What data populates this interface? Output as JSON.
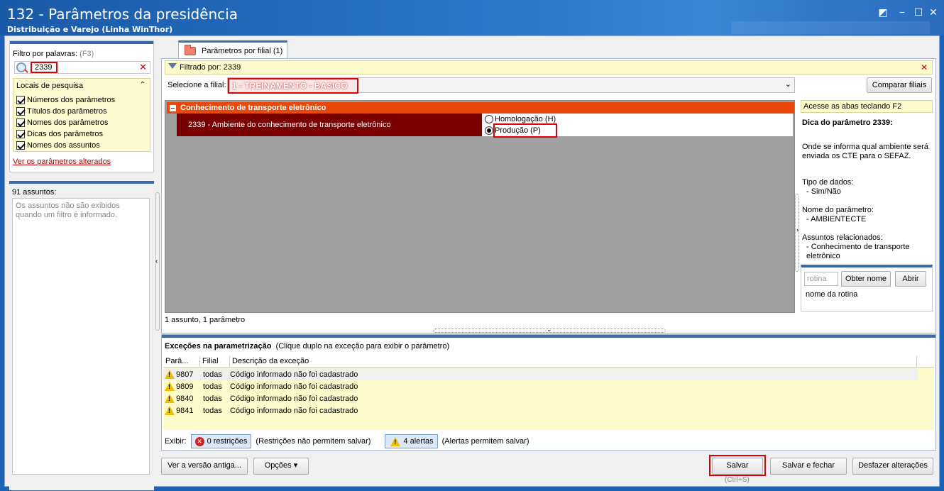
{
  "window": {
    "title": "132 - Parâmetros da presidência",
    "subtitle": "Distribuição e Varejo (Linha WinThor)",
    "controls": [
      "restore-icon",
      "minimize-icon",
      "maximize-icon",
      "close-icon"
    ]
  },
  "filter": {
    "label": "Filtro por palavras:",
    "shortcut": "(F3)",
    "value": "2339",
    "search_locations_title": "Locais de pesquisa",
    "locations": [
      "Números dos parâmetros",
      "Títulos dos parâmetros",
      "Nomes dos parâmetros",
      "Dicas dos parâmetros",
      "Nomes dos assuntos"
    ],
    "altered_link": "Ver os parâmetros alterados"
  },
  "subjects": {
    "count_label": "91 assuntos:",
    "empty_message": "Os assuntos não são exibidos quando um filtro é informado."
  },
  "tab": {
    "label": "Parâmetros por filial",
    "count": "(1)"
  },
  "filtered_by": "Filtrado por: 2339",
  "branch": {
    "label": "Selecione a filial:",
    "value": "1 - TREINAMENTO - BASICO",
    "compare_button": "Comparar filiais"
  },
  "group": {
    "title": "Conhecimento de transporte eletrônico",
    "param_name": "2339 - Ambiente do conhecimento de transporte eletrônico",
    "options": [
      {
        "label": "Homologação (H)",
        "selected": false
      },
      {
        "label": "Produção (P)",
        "selected": true
      }
    ]
  },
  "status_line": "1 assunto, 1 parâmetro",
  "tip": {
    "access_hint": "Acesse as abas teclando F2",
    "title": "Dica do parâmetro 2339:",
    "description": "Onde se informa qual ambiente será enviada os CTE para o SEFAZ.",
    "data_type_label": "Tipo de dados:",
    "data_type_value": "- Sim/Não",
    "param_name_label": "Nome do parâmetro:",
    "param_name_value": "- AMBIENTECTE",
    "related_label": "Assuntos relacionados:",
    "related_value": "- Conhecimento de transporte eletrônico",
    "routine_placeholder": "rotina",
    "get_name_button": "Obter nome",
    "open_button": "Abrir",
    "routine_name_label": "nome da rotina"
  },
  "exceptions": {
    "title": "Exceções na parametrização",
    "hint": "(Clique duplo na exceção para exibir o parâmetro)",
    "columns": [
      "Parâ...",
      "Filial",
      "Descrição da exceção"
    ],
    "rows": [
      {
        "param": "9807",
        "branch": "todas",
        "description": "Código informado não foi cadastrado"
      },
      {
        "param": "9809",
        "branch": "todas",
        "description": "Código informado não foi cadastrado"
      },
      {
        "param": "9840",
        "branch": "todas",
        "description": "Código informado não foi cadastrado"
      },
      {
        "param": "9841",
        "branch": "todas",
        "description": "Código informado não foi cadastrado"
      }
    ],
    "show_label": "Exibir:",
    "restrictions_button": "0 restrições",
    "restrictions_note": "(Restrições não permitem salvar)",
    "alerts_button": "4 alertas",
    "alerts_note": "(Alertas permitem salvar)"
  },
  "footer": {
    "old_version_button": "Ver a versão antiga...",
    "options_button": "Opções",
    "save_button": "Salvar",
    "save_shortcut": "(Ctrl+S)",
    "save_close_button": "Salvar e fechar",
    "undo_button": "Desfazer alterações"
  }
}
